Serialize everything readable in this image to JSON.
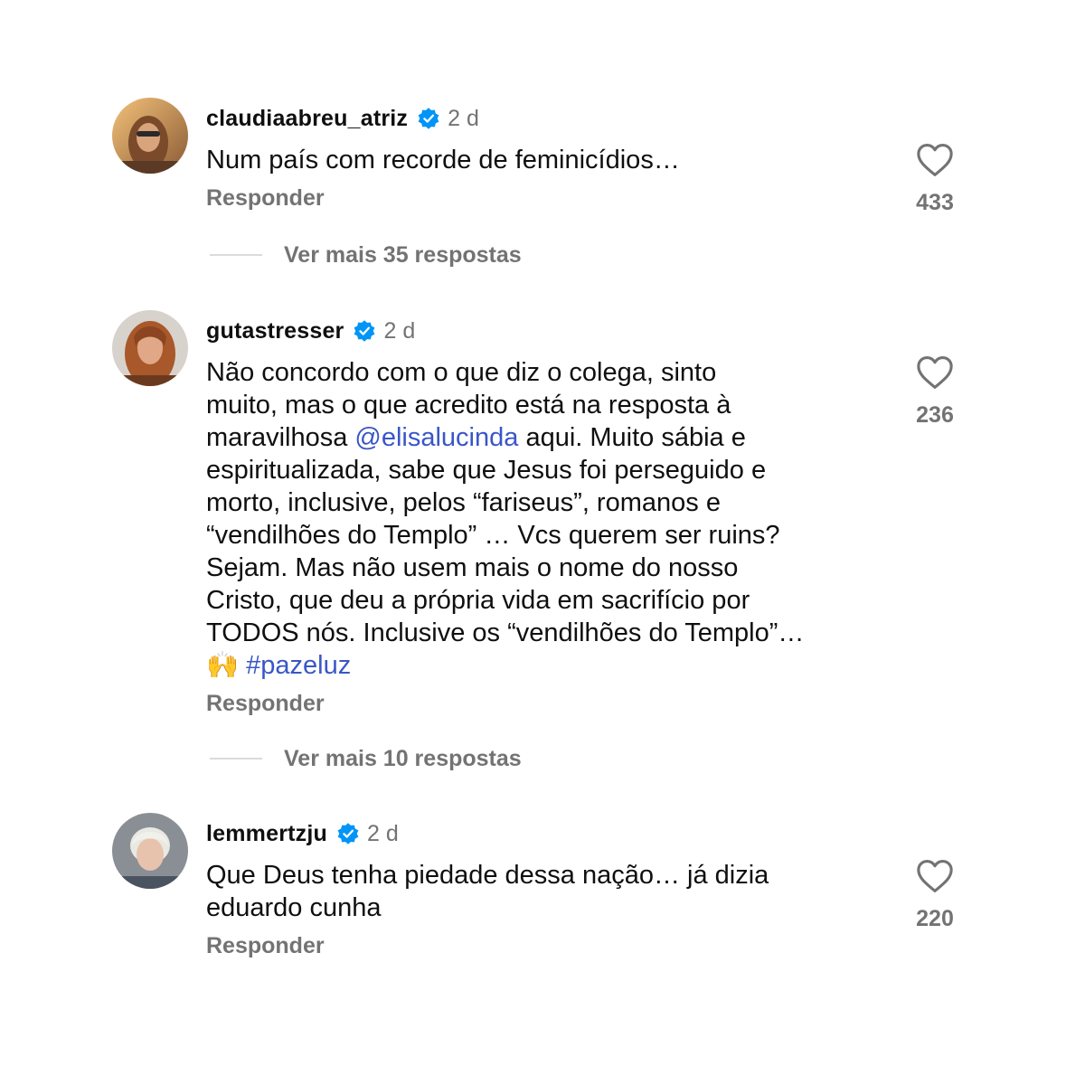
{
  "comments": [
    {
      "username": "claudiaabreu_atriz",
      "time": "2 d",
      "text_parts": [
        "Num país com recorde de feminicídios…"
      ],
      "reply_label": "Responder",
      "likes": "433",
      "more_replies": "Ver mais 35 respostas",
      "avatar_icon": "avatar-photo"
    },
    {
      "username": "gutastresser",
      "time": "2 d",
      "text_before_mention": "Não concordo com o que diz o colega, sinto\nmuito, mas o que acredito está na resposta à\nmaravilhosa ",
      "mention": "@elisalucinda",
      "text_after_mention": " aqui. Muito sábia e\nespiritualizada, sabe que Jesus foi perseguido e\nmorto, inclusive, pelos “fariseus”, romanos e\n“vendilhões do Templo” … Vcs querem ser ruins?\nSejam. Mas não usem mais o nome do nosso\nCristo, que deu a própria vida em sacrifício por\nTODOS nós. Inclusive os “vendilhões do Templo”…\n🙌 ",
      "hashtag": "#pazeluz",
      "reply_label": "Responder",
      "likes": "236",
      "more_replies": "Ver mais 10 respostas",
      "avatar_icon": "avatar-photo"
    },
    {
      "username": "lemmertzju",
      "time": "2 d",
      "text": "Que Deus tenha piedade dessa nação… já dizia\neduardo cunha",
      "reply_label": "Responder",
      "likes": "220",
      "avatar_icon": "avatar-photo"
    }
  ],
  "colors": {
    "verified": "#0095f6",
    "link": "#3a56c7",
    "secondary_text": "#737373"
  }
}
